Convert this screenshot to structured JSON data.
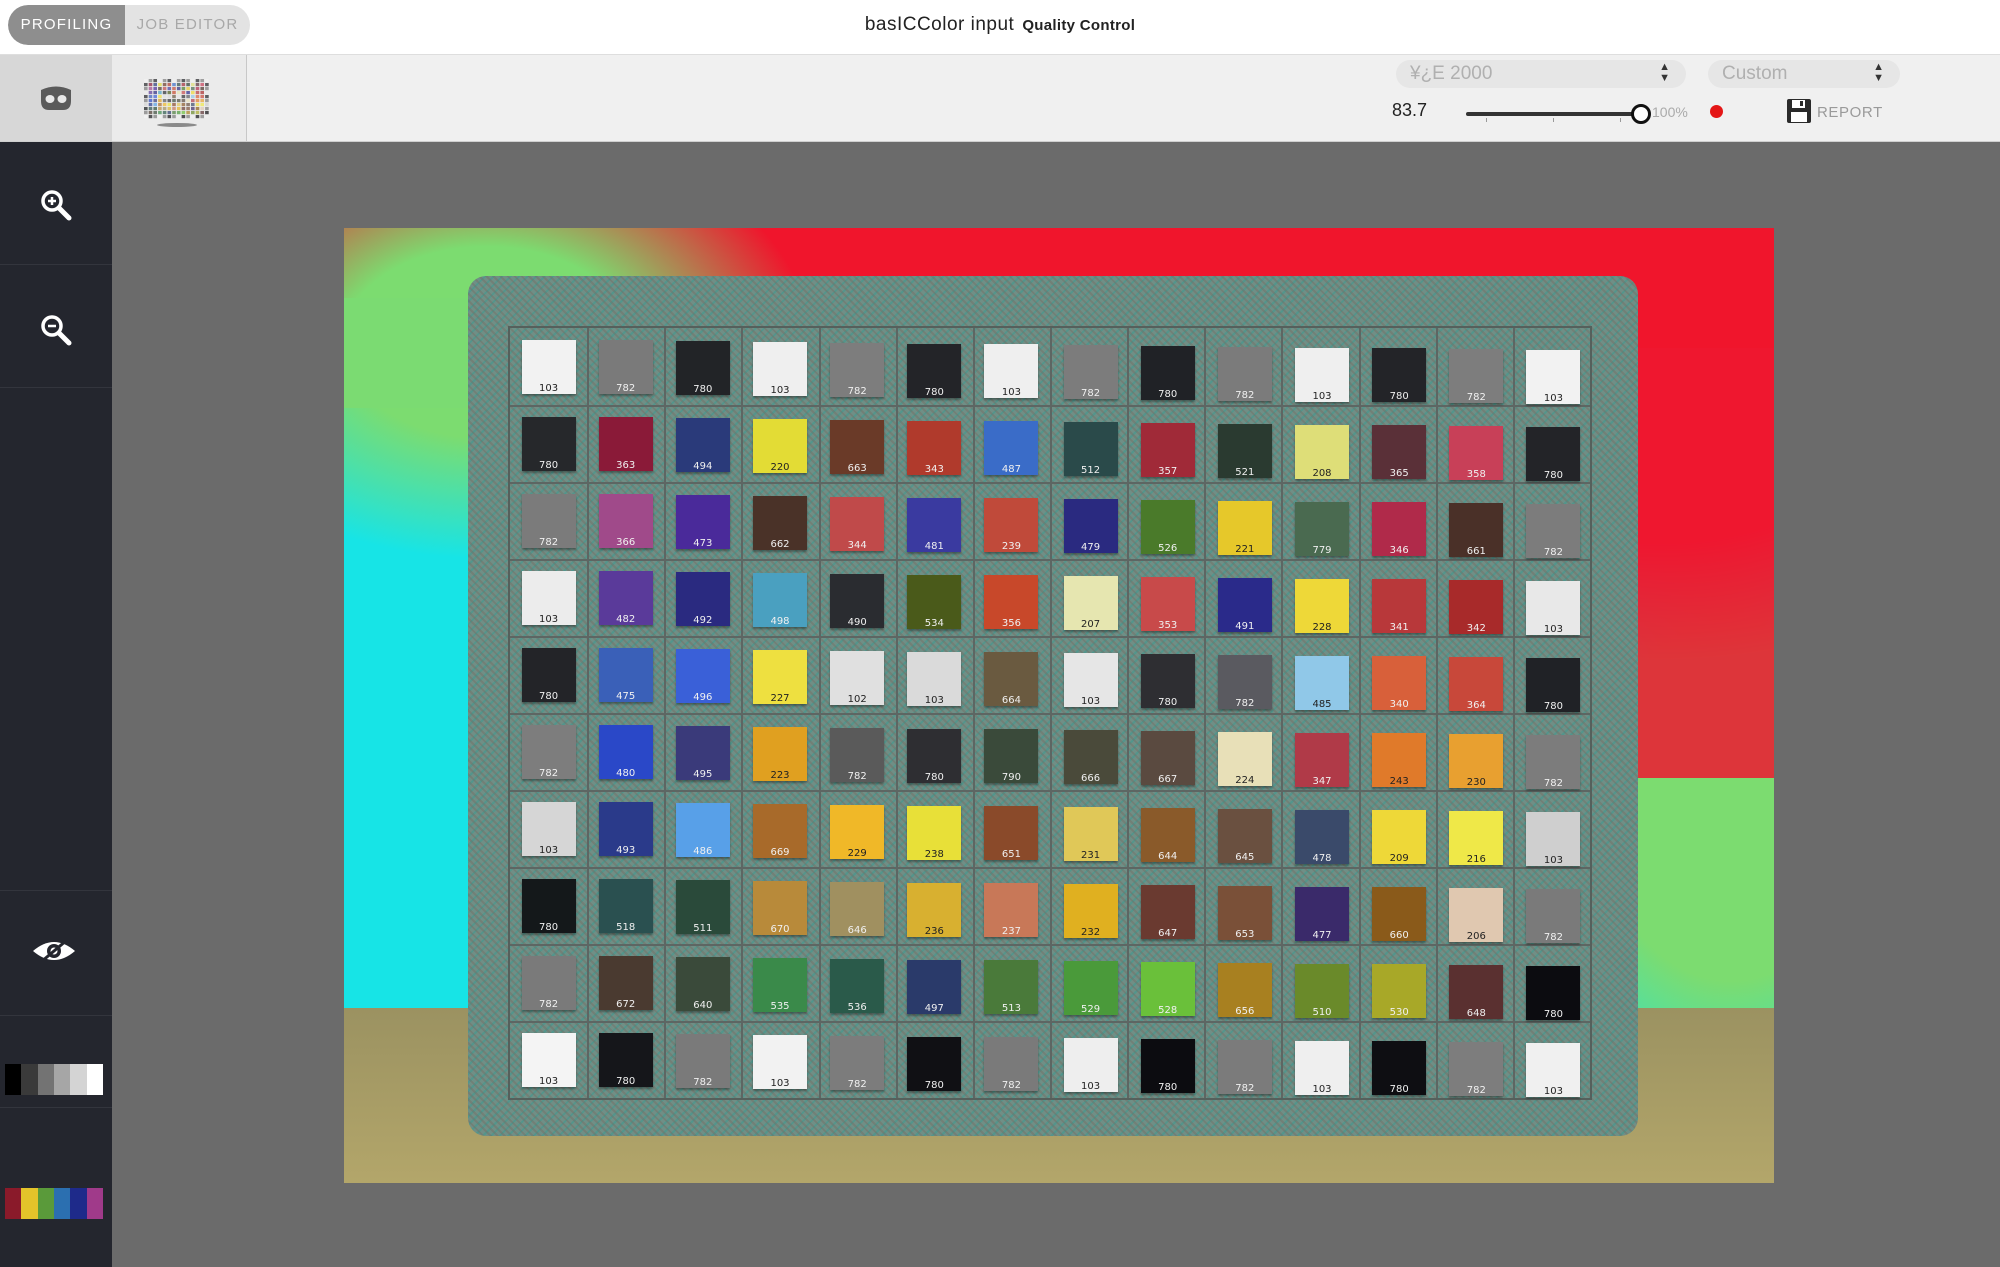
{
  "top_bar": {
    "mode_tabs": [
      {
        "label": "PROFILING",
        "active": true
      },
      {
        "label": "JOB EDITOR",
        "active": false
      }
    ],
    "app_title": "basICColor input",
    "app_subtitle": "Quality Control"
  },
  "toolbar": {
    "delta_e_select": "¥¿E 2000",
    "preset_select": "Custom",
    "value": "83.7",
    "slider": {
      "value_percent": 100,
      "label": "100%"
    },
    "status_color": "#e41616",
    "report_label": "REPORT"
  },
  "sidebar": {
    "icons": [
      "zoom-in-icon",
      "zoom-out-icon",
      "eye-icon"
    ],
    "gray_swatches": [
      "#000000",
      "#3a3a3a",
      "#737373",
      "#a6a6a6",
      "#d4d4d4",
      "#ffffff"
    ],
    "color_swatches": [
      "#8a1a2a",
      "#e3c32a",
      "#5a9a3a",
      "#2b6fb0",
      "#1e2a8a",
      "#a03a8a"
    ]
  },
  "chart": {
    "rows": [
      [
        [
          "103",
          "#f2f2f2",
          "d"
        ],
        [
          "782",
          "#7a7a7a",
          "l"
        ],
        [
          "780",
          "#222427",
          "l"
        ],
        [
          "103",
          "#efefef",
          "d"
        ],
        [
          "782",
          "#7d7d7d",
          "l"
        ],
        [
          "780",
          "#232428",
          "l"
        ],
        [
          "103",
          "#efefef",
          "d"
        ],
        [
          "782",
          "#7c7c7c",
          "l"
        ],
        [
          "780",
          "#202226",
          "l"
        ],
        [
          "782",
          "#7b7b7b",
          "l"
        ],
        [
          "103",
          "#efefef",
          "d"
        ],
        [
          "780",
          "#232428",
          "l"
        ],
        [
          "782",
          "#7d7d7d",
          "l"
        ],
        [
          "103",
          "#f2f2f2",
          "d"
        ]
      ],
      [
        [
          "780",
          "#26282b",
          "l"
        ],
        [
          "363",
          "#8a1a38",
          "l"
        ],
        [
          "494",
          "#2a3a7a",
          "l"
        ],
        [
          "220",
          "#e3dc35",
          "d"
        ],
        [
          "663",
          "#6a3a28",
          "l"
        ],
        [
          "343",
          "#b03a2c",
          "l"
        ],
        [
          "487",
          "#3a6cc8",
          "l"
        ],
        [
          "512",
          "#2a4a4a",
          "l"
        ],
        [
          "357",
          "#a02a38",
          "l"
        ],
        [
          "521",
          "#2a3a30",
          "l"
        ],
        [
          "208",
          "#dede78",
          "d"
        ],
        [
          "365",
          "#5a3038",
          "l"
        ],
        [
          "358",
          "#c84058",
          "l"
        ],
        [
          "780",
          "#232428",
          "l"
        ]
      ],
      [
        [
          "782",
          "#7b7b7b",
          "l"
        ],
        [
          "366",
          "#a04a8a",
          "l"
        ],
        [
          "473",
          "#4a2a9a",
          "l"
        ],
        [
          "662",
          "#4a3228",
          "l"
        ],
        [
          "344",
          "#c04a4a",
          "l"
        ],
        [
          "481",
          "#3a3aa0",
          "l"
        ],
        [
          "239",
          "#c04a3a",
          "l"
        ],
        [
          "479",
          "#2a2a80",
          "l"
        ],
        [
          "526",
          "#4a7a2a",
          "l"
        ],
        [
          "221",
          "#e6c82a",
          "d"
        ],
        [
          "779",
          "#4a6a50",
          "l"
        ],
        [
          "346",
          "#b02a4a",
          "l"
        ],
        [
          "661",
          "#4a3028",
          "l"
        ],
        [
          "782",
          "#7c7c7c",
          "l"
        ]
      ],
      [
        [
          "103",
          "#ececec",
          "d"
        ],
        [
          "482",
          "#5a3a9a",
          "l"
        ],
        [
          "492",
          "#2a2a80",
          "l"
        ],
        [
          "498",
          "#4aa0c0",
          "l"
        ],
        [
          "490",
          "#2a2c30",
          "l"
        ],
        [
          "534",
          "#4a5a1a",
          "l"
        ],
        [
          "356",
          "#c8482a",
          "l"
        ],
        [
          "207",
          "#e6e6b0",
          "d"
        ],
        [
          "353",
          "#c84a4a",
          "l"
        ],
        [
          "491",
          "#2a2a8a",
          "l"
        ],
        [
          "228",
          "#eed838",
          "d"
        ],
        [
          "341",
          "#b8383a",
          "l"
        ],
        [
          "342",
          "#a82a2a",
          "l"
        ],
        [
          "103",
          "#e8e8e8",
          "d"
        ]
      ],
      [
        [
          "780",
          "#232428",
          "l"
        ],
        [
          "475",
          "#3a60b8",
          "l"
        ],
        [
          "496",
          "#3a60d8",
          "l"
        ],
        [
          "227",
          "#eee040",
          "d"
        ],
        [
          "102",
          "#e0e0e0",
          "d"
        ],
        [
          "103",
          "#dadada",
          "d"
        ],
        [
          "664",
          "#6a5a40",
          "l"
        ],
        [
          "103",
          "#e6e6e6",
          "d"
        ],
        [
          "780",
          "#2e2e32",
          "l"
        ],
        [
          "782",
          "#5a5a60",
          "l"
        ],
        [
          "485",
          "#90c8e8",
          "d"
        ],
        [
          "340",
          "#d8603a",
          "l"
        ],
        [
          "364",
          "#c8483a",
          "l"
        ],
        [
          "780",
          "#202226",
          "l"
        ]
      ],
      [
        [
          "782",
          "#7d7d7d",
          "l"
        ],
        [
          "480",
          "#2a48c8",
          "l"
        ],
        [
          "495",
          "#3a3a7a",
          "l"
        ],
        [
          "223",
          "#e0a020",
          "d"
        ],
        [
          "782",
          "#5a5a5a",
          "l"
        ],
        [
          "780",
          "#2e2e32",
          "l"
        ],
        [
          "790",
          "#3a4a3a",
          "l"
        ],
        [
          "666",
          "#4a4a3a",
          "l"
        ],
        [
          "667",
          "#5a4a40",
          "l"
        ],
        [
          "224",
          "#e8e0b8",
          "d"
        ],
        [
          "347",
          "#b03a48",
          "l"
        ],
        [
          "243",
          "#e07a2a",
          "d"
        ],
        [
          "230",
          "#e8a030",
          "d"
        ],
        [
          "782",
          "#7c7c7c",
          "l"
        ]
      ],
      [
        [
          "103",
          "#d6d6d6",
          "d"
        ],
        [
          "493",
          "#2a3a8a",
          "l"
        ],
        [
          "486",
          "#58a0e8",
          "l"
        ],
        [
          "669",
          "#a86a2a",
          "l"
        ],
        [
          "229",
          "#f0b828",
          "d"
        ],
        [
          "238",
          "#e8e038",
          "d"
        ],
        [
          "651",
          "#8a4a2a",
          "l"
        ],
        [
          "231",
          "#e0c858",
          "d"
        ],
        [
          "644",
          "#8a5a2a",
          "l"
        ],
        [
          "645",
          "#6a5040",
          "l"
        ],
        [
          "478",
          "#3a4a6a",
          "l"
        ],
        [
          "209",
          "#eed838",
          "d"
        ],
        [
          "216",
          "#efe848",
          "d"
        ],
        [
          "103",
          "#cfcfcf",
          "d"
        ]
      ],
      [
        [
          "780",
          "#14181a",
          "l"
        ],
        [
          "518",
          "#2a5050",
          "l"
        ],
        [
          "511",
          "#2a4a3a",
          "l"
        ],
        [
          "670",
          "#b88a3a",
          "l"
        ],
        [
          "646",
          "#a09060",
          "l"
        ],
        [
          "236",
          "#d8b030",
          "d"
        ],
        [
          "237",
          "#c87858",
          "l"
        ],
        [
          "232",
          "#e0b020",
          "d"
        ],
        [
          "647",
          "#6a3a30",
          "l"
        ],
        [
          "653",
          "#7a5038",
          "l"
        ],
        [
          "477",
          "#3a2a6a",
          "l"
        ],
        [
          "660",
          "#8a5a1a",
          "l"
        ],
        [
          "206",
          "#e0c8b0",
          "d"
        ],
        [
          "782",
          "#7a7a7a",
          "l"
        ]
      ],
      [
        [
          "782",
          "#7a7a7a",
          "l"
        ],
        [
          "672",
          "#4a3a30",
          "l"
        ],
        [
          "640",
          "#3a4a3a",
          "l"
        ],
        [
          "535",
          "#3a8a4a",
          "l"
        ],
        [
          "536",
          "#2a5a4a",
          "l"
        ],
        [
          "497",
          "#2a3a6a",
          "l"
        ],
        [
          "513",
          "#4a7a3a",
          "l"
        ],
        [
          "529",
          "#4a9a3a",
          "l"
        ],
        [
          "528",
          "#6ac03a",
          "l"
        ],
        [
          "656",
          "#a88020",
          "l"
        ],
        [
          "510",
          "#6a8a2a",
          "l"
        ],
        [
          "530",
          "#a8a828",
          "l"
        ],
        [
          "648",
          "#5a3030",
          "l"
        ],
        [
          "780",
          "#0c0c10",
          "l"
        ]
      ],
      [
        [
          "103",
          "#f4f4f4",
          "d"
        ],
        [
          "780",
          "#15161a",
          "l"
        ],
        [
          "782",
          "#7a7a7a",
          "l"
        ],
        [
          "103",
          "#f2f2f2",
          "d"
        ],
        [
          "782",
          "#7c7c7c",
          "l"
        ],
        [
          "780",
          "#101014",
          "l"
        ],
        [
          "782",
          "#7a7a7a",
          "l"
        ],
        [
          "103",
          "#eeeeee",
          "d"
        ],
        [
          "780",
          "#0c0c10",
          "l"
        ],
        [
          "782",
          "#7b7b7b",
          "l"
        ],
        [
          "103",
          "#efefef",
          "d"
        ],
        [
          "780",
          "#0e0e12",
          "l"
        ],
        [
          "782",
          "#7d7d7d",
          "l"
        ],
        [
          "103",
          "#f0f0f0",
          "d"
        ]
      ]
    ]
  }
}
